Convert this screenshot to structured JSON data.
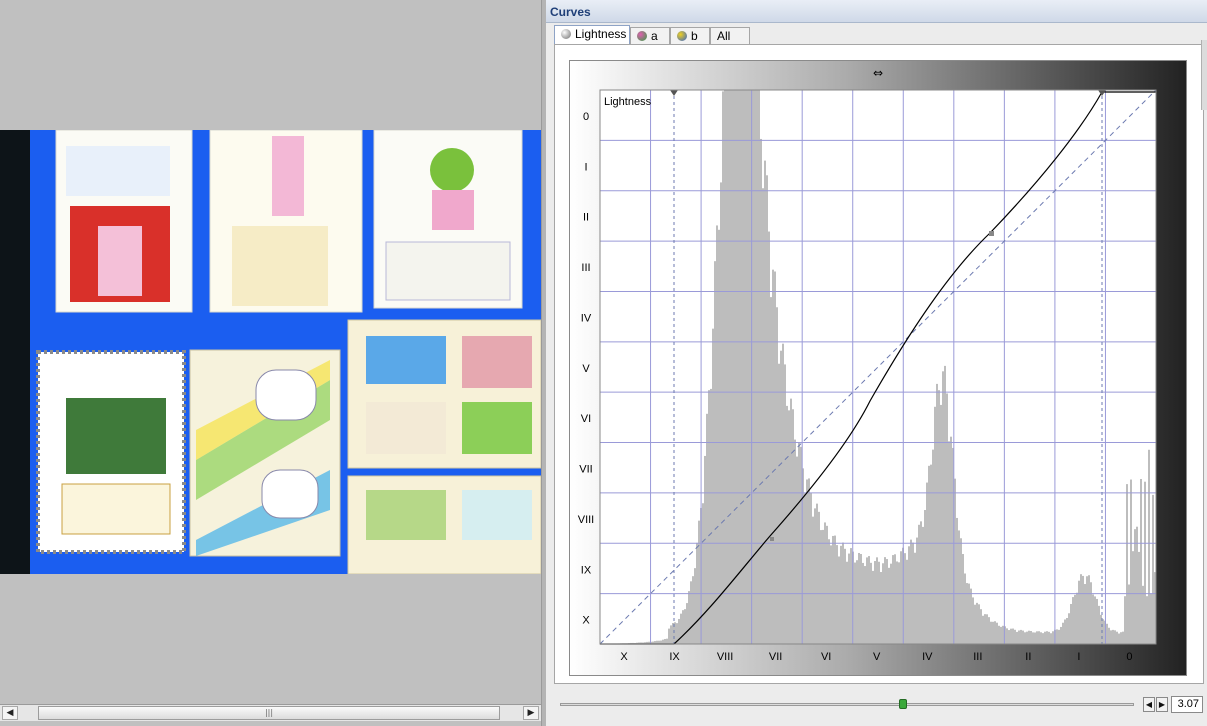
{
  "panel": {
    "title": "Curves"
  },
  "tabs": [
    {
      "label": "Lightness",
      "icon": "lightness-channel-icon",
      "active": true
    },
    {
      "label": "a",
      "icon": "a-channel-icon",
      "active": false
    },
    {
      "label": "b",
      "icon": "b-channel-icon",
      "active": false
    },
    {
      "label": "All",
      "icon": "",
      "active": false
    }
  ],
  "curve": {
    "channel_label": "Lightness",
    "zone_labels_y": [
      "0",
      "I",
      "II",
      "III",
      "IV",
      "V",
      "VI",
      "VII",
      "VIII",
      "IX",
      "X"
    ],
    "zone_labels_x": [
      "X",
      "IX",
      "VIII",
      "VII",
      "VI",
      "V",
      "IV",
      "III",
      "II",
      "I",
      "0"
    ],
    "colors": {
      "grid": "#9a9ad8",
      "histogram": "#bdbdbd",
      "curve": "#000000",
      "diagonal": "#6c7ab0"
    }
  },
  "gamma": {
    "value": "3.07",
    "slider_fraction": 0.6
  },
  "scrollbar": {
    "grip": "|||"
  },
  "icons": {
    "left": "arrow-left-icon",
    "right": "arrow-right-icon"
  }
}
